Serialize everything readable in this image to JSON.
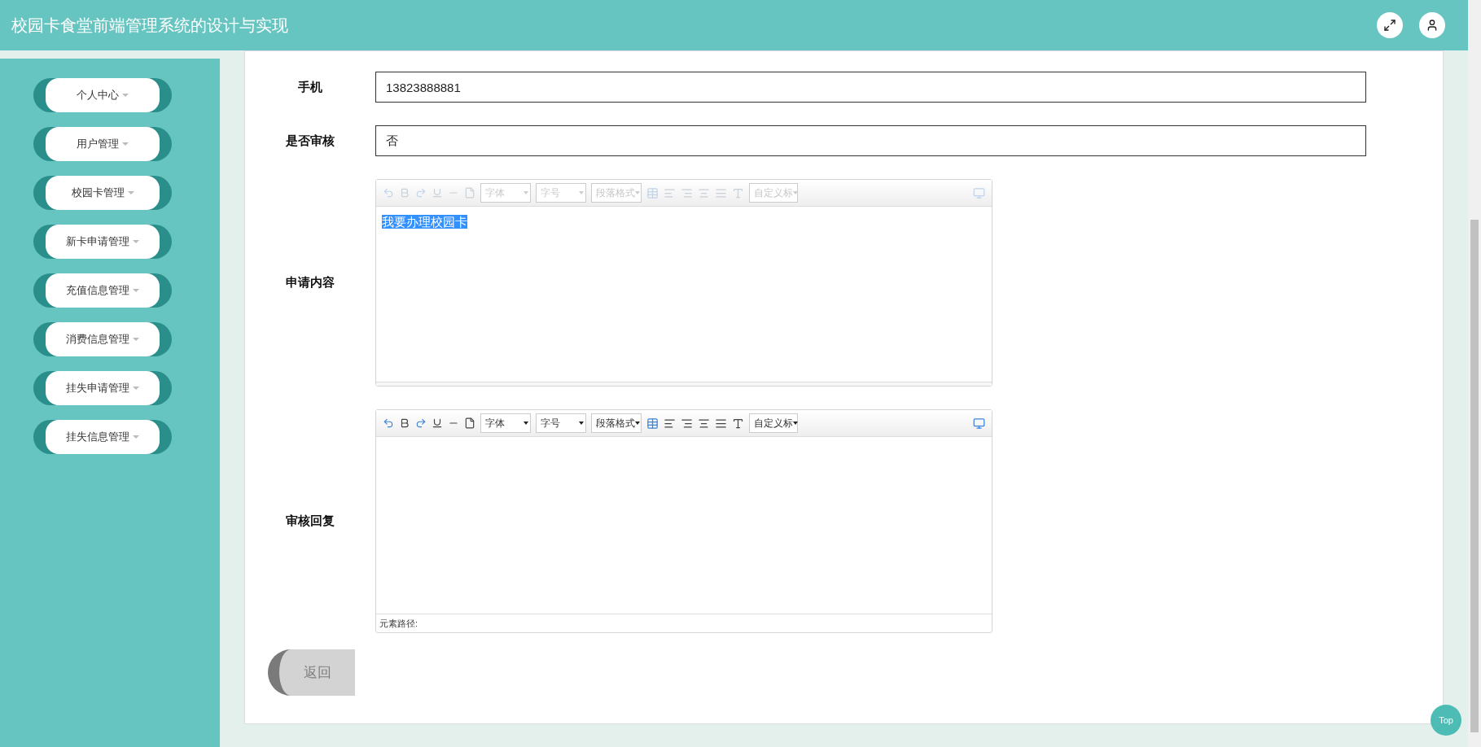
{
  "header": {
    "title": "校园卡食堂前端管理系统的设计与实现"
  },
  "sidebar": {
    "items": [
      {
        "label": "个人中心"
      },
      {
        "label": "用户管理"
      },
      {
        "label": "校园卡管理"
      },
      {
        "label": "新卡申请管理"
      },
      {
        "label": "充值信息管理"
      },
      {
        "label": "消费信息管理"
      },
      {
        "label": "挂失申请管理"
      },
      {
        "label": "挂失信息管理"
      }
    ]
  },
  "form": {
    "fields": [
      {
        "kind": "input",
        "label": "手机",
        "value": "13823888881"
      },
      {
        "kind": "input",
        "label": "是否审核",
        "value": "否"
      },
      {
        "kind": "editor",
        "label": "申请内容",
        "disabled": true,
        "content": "我要办理校园卡",
        "content_selected": true,
        "selects": [
          "字体",
          "字号",
          "段落格式",
          "自定义标"
        ]
      },
      {
        "kind": "editor",
        "label": "审核回复",
        "disabled": false,
        "selects": [
          "字体",
          "字号",
          "段落格式",
          "自定义标"
        ],
        "path_label": "元素路径:"
      }
    ]
  },
  "return_button": {
    "label": "返回"
  },
  "top_button": {
    "label": "Top"
  }
}
